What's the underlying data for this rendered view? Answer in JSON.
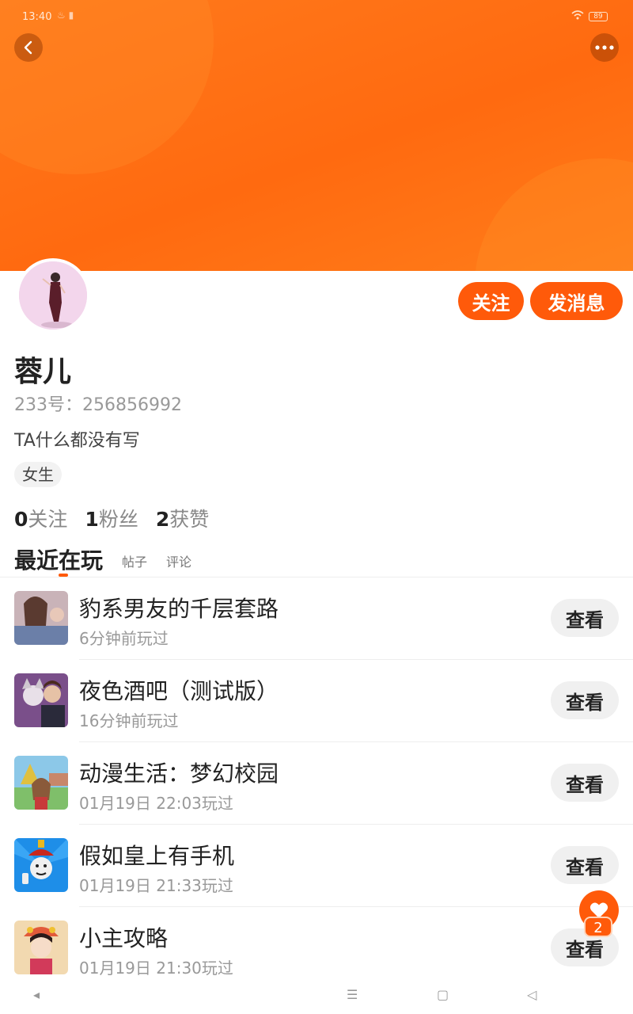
{
  "status_bar": {
    "time": "13:40",
    "battery": "89"
  },
  "profile": {
    "name": "蓉儿",
    "uid_label": "233号：",
    "uid": "256856992",
    "bio": "TA什么都没有写",
    "tag": "女生",
    "follow_button": "关注",
    "message_button": "发消息"
  },
  "stats": [
    {
      "num": "0",
      "label": "关注"
    },
    {
      "num": "1",
      "label": "粉丝"
    },
    {
      "num": "2",
      "label": "获赞"
    }
  ],
  "tabs": {
    "active": "最近在玩",
    "posts": "帖子",
    "comments": "评论"
  },
  "games": [
    {
      "title": "豹系男友的千层套路",
      "time": "6分钟前玩过",
      "button": "查看"
    },
    {
      "title": "夜色酒吧（测试版）",
      "time": "16分钟前玩过",
      "button": "查看"
    },
    {
      "title": "动漫生活：梦幻校园",
      "time": "01月19日 22:03玩过",
      "button": "查看"
    },
    {
      "title": "假如皇上有手机",
      "time": "01月19日 21:33玩过",
      "button": "查看"
    },
    {
      "title": "小主攻略",
      "time": "01月19日 21:30玩过",
      "button": "查看"
    }
  ],
  "fab": {
    "badge": "2"
  },
  "colors": {
    "accent": "#ff5a0a",
    "header": "#ff6a10"
  },
  "nav_icons": [
    "back-triangle-icon",
    "menu-icon",
    "home-square-icon",
    "recent-triangle-icon"
  ]
}
